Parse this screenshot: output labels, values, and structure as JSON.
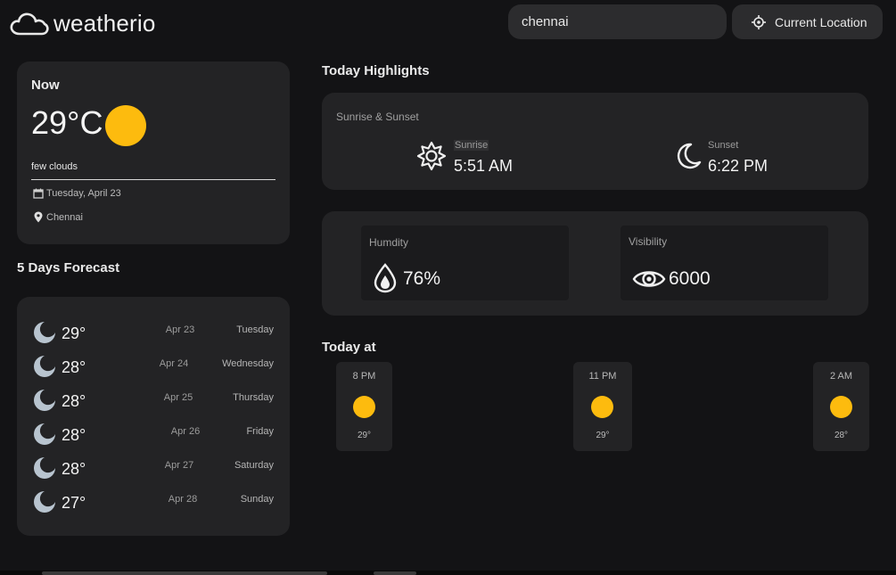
{
  "header": {
    "app_name": "weatherio",
    "search_value": "chennai",
    "location_button": "Current Location"
  },
  "now": {
    "title": "Now",
    "temperature": "29°C",
    "description": "few clouds",
    "date": "Tuesday, April 23",
    "location": "Chennai",
    "weather_icon": "sun-icon"
  },
  "forecast": {
    "title": "5 Days Forecast",
    "days": [
      {
        "temp": "29°",
        "date": "Apr 23",
        "day": "Tuesday",
        "icon": "moon-icon"
      },
      {
        "temp": "28°",
        "date": "Apr 24",
        "day": "Wednesday",
        "icon": "moon-icon"
      },
      {
        "temp": "28°",
        "date": "Apr 25",
        "day": "Thursday",
        "icon": "moon-icon"
      },
      {
        "temp": "28°",
        "date": "Apr 26",
        "day": "Friday",
        "icon": "moon-icon"
      },
      {
        "temp": "28°",
        "date": "Apr 27",
        "day": "Saturday",
        "icon": "moon-icon"
      },
      {
        "temp": "27°",
        "date": "Apr 28",
        "day": "Sunday",
        "icon": "moon-icon"
      }
    ]
  },
  "highlights": {
    "title": "Today Highlights",
    "sun_card_title": "Sunrise & Sunset",
    "sunrise_label": "Sunrise",
    "sunrise_time": "5:51 AM",
    "sunset_label": "Sunset",
    "sunset_time": "6:22 PM",
    "humidity_label": "Humdity",
    "humidity_value": "76%",
    "visibility_label": "Visibility",
    "visibility_value": "6000"
  },
  "today_at": {
    "title": "Today at",
    "hours": [
      {
        "time": "8 PM",
        "temp": "29°",
        "icon": "sun-icon"
      },
      {
        "time": "11 PM",
        "temp": "29°",
        "icon": "sun-icon"
      },
      {
        "time": "2 AM",
        "temp": "28°",
        "icon": "sun-icon"
      }
    ]
  },
  "colors": {
    "background": "#131315",
    "card": "#232325",
    "sun": "#fdbb0e",
    "moon": "#b8c4cf"
  }
}
